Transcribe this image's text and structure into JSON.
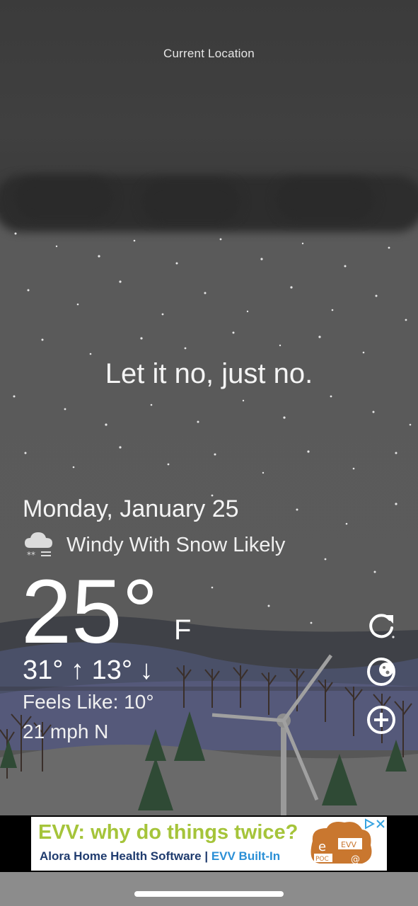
{
  "header": {
    "location": "Current Location"
  },
  "message": {
    "tagline": "Let it no, just no."
  },
  "weather": {
    "date": "Monday, January 25",
    "condition_icon": "snow-cloud-icon",
    "condition": "Windy With Snow Likely",
    "temperature": "25°",
    "unit": "F",
    "high_low": "31° ↑  13° ↓",
    "feels_like": "Feels Like: 10°",
    "wind": "21 mph N"
  },
  "controls": [
    {
      "name": "refresh-icon"
    },
    {
      "name": "moon-icon"
    },
    {
      "name": "add-icon"
    }
  ],
  "ad": {
    "title": "EVV: why do things twice?",
    "subtitle_a": "Alora Home Health Software",
    "subtitle_sep": " | ",
    "subtitle_b": "EVV Built-In",
    "badge_icons": [
      "adchoices-icon",
      "close-icon"
    ],
    "image_labels": [
      "e",
      "EVV",
      "POC",
      "@"
    ]
  },
  "colors": {
    "ad_title": "#a5c43a",
    "ad_subtitle": "#1f3b6e",
    "sky": "#5a5a5a",
    "cloud": "#2d2d2d"
  }
}
